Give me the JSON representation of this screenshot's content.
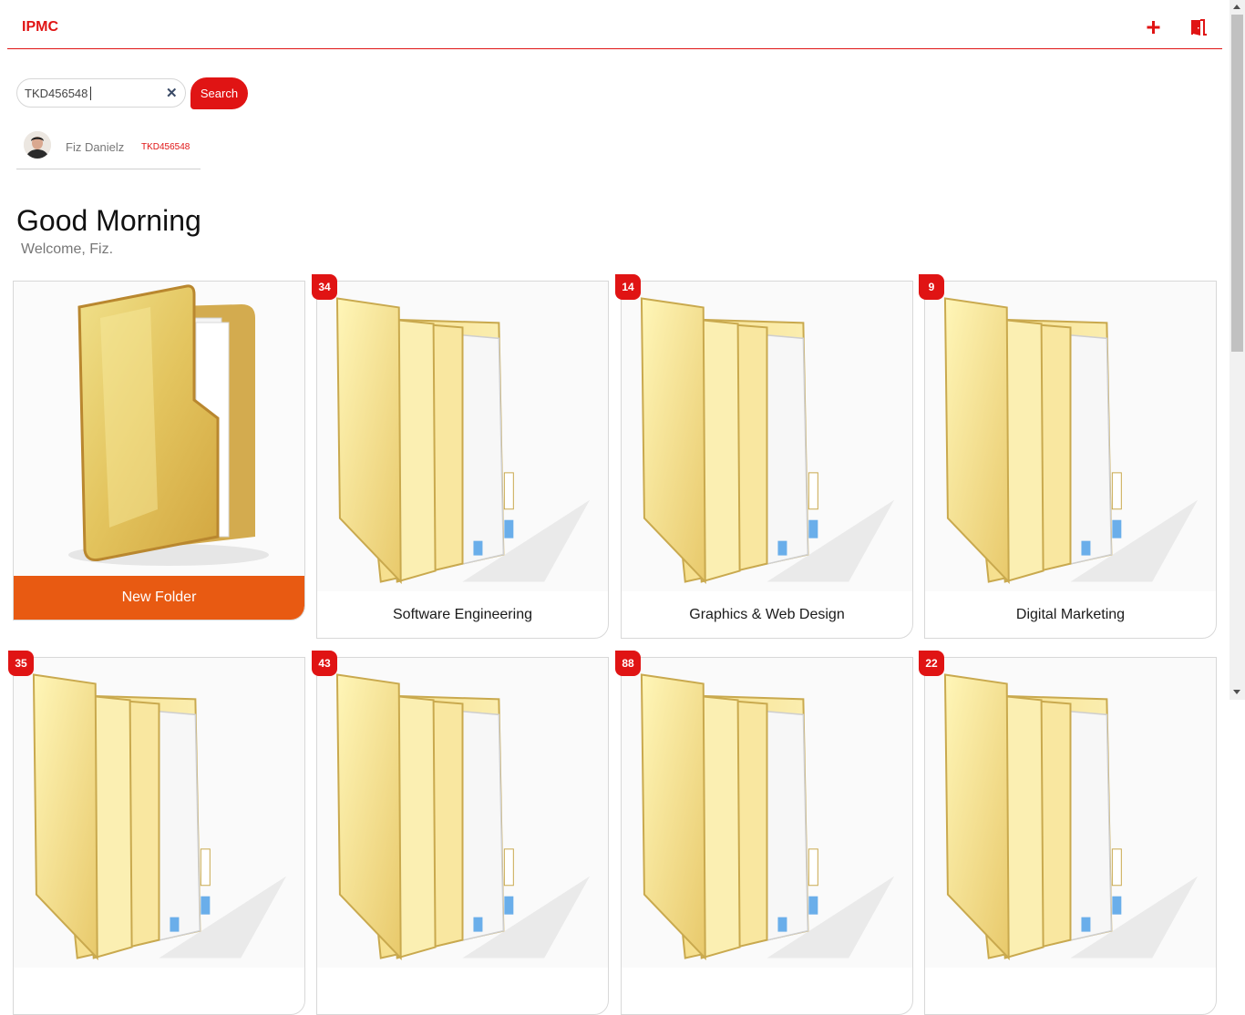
{
  "app": {
    "brand": "IPMC"
  },
  "header": {
    "add_icon": "plus-icon",
    "logout_icon": "door-exit-icon"
  },
  "search": {
    "value": "TKD456548",
    "button_label": "Search",
    "clear_icon": "close-icon"
  },
  "result": {
    "name": "Fiz Danielz",
    "id": "TKD456548"
  },
  "greeting": {
    "title": "Good Morning",
    "subtitle": "Welcome, Fiz."
  },
  "new_folder": {
    "label": "New Folder"
  },
  "folders": [
    {
      "name": "Software Engineering",
      "count": "34"
    },
    {
      "name": "Graphics & Web Design",
      "count": "14"
    },
    {
      "name": "Digital Marketing",
      "count": "9"
    }
  ],
  "folders_row2": [
    {
      "count": "35"
    },
    {
      "count": "43"
    },
    {
      "count": "88"
    },
    {
      "count": "22"
    }
  ],
  "colors": {
    "accent": "#e01414",
    "orange": "#e85a12"
  }
}
